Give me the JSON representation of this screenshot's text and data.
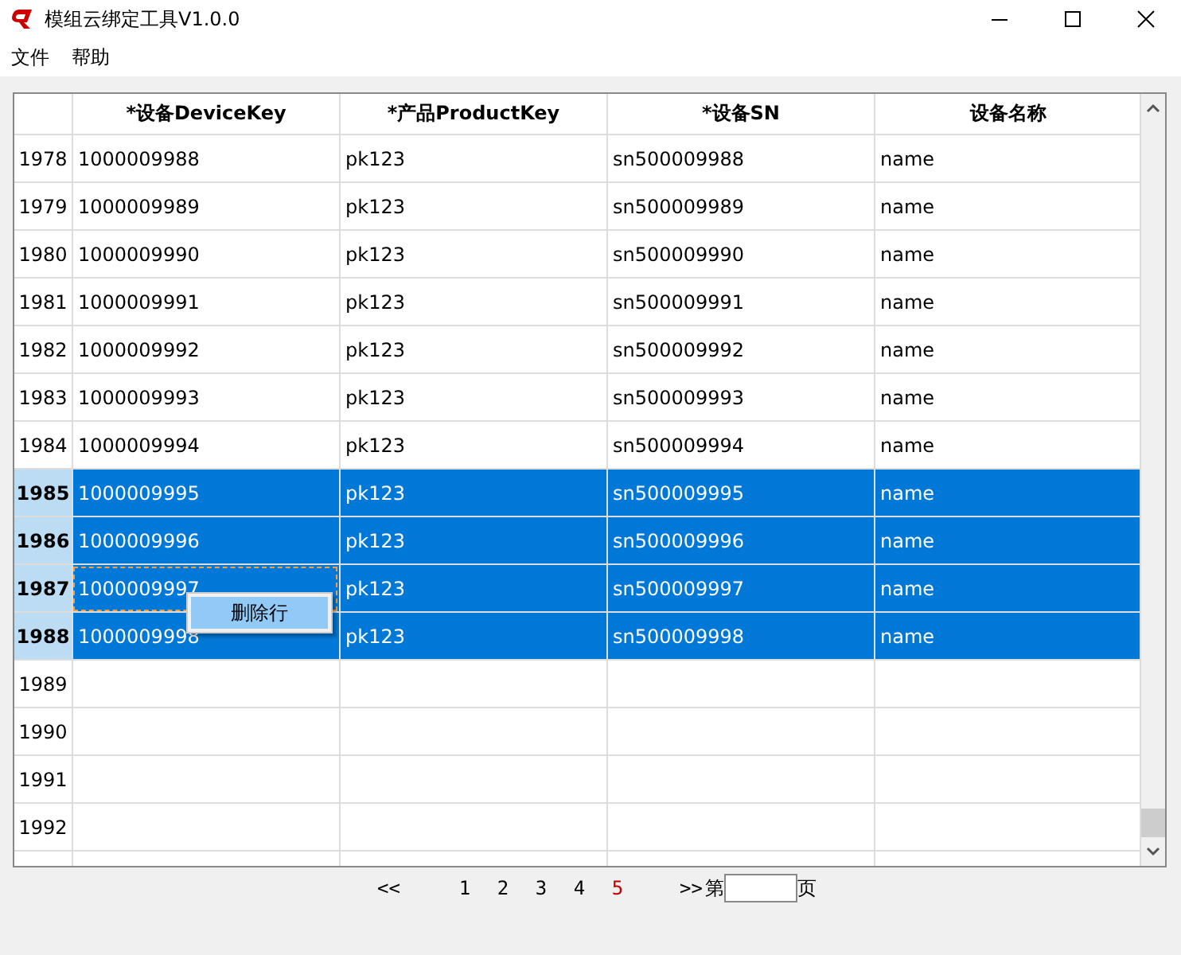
{
  "window": {
    "title": "模组云绑定工具V1.0.0"
  },
  "menu": [
    "文件",
    "帮助"
  ],
  "table": {
    "columns": [
      "*设备DeviceKey",
      "*产品ProductKey",
      "*设备SN",
      "设备名称"
    ],
    "rows": [
      {
        "number": "1978",
        "cells": [
          "1000009988",
          "pk123",
          "sn500009988",
          "name"
        ],
        "selected": false,
        "focused": false
      },
      {
        "number": "1979",
        "cells": [
          "1000009989",
          "pk123",
          "sn500009989",
          "name"
        ],
        "selected": false,
        "focused": false
      },
      {
        "number": "1980",
        "cells": [
          "1000009990",
          "pk123",
          "sn500009990",
          "name"
        ],
        "selected": false,
        "focused": false
      },
      {
        "number": "1981",
        "cells": [
          "1000009991",
          "pk123",
          "sn500009991",
          "name"
        ],
        "selected": false,
        "focused": false
      },
      {
        "number": "1982",
        "cells": [
          "1000009992",
          "pk123",
          "sn500009992",
          "name"
        ],
        "selected": false,
        "focused": false
      },
      {
        "number": "1983",
        "cells": [
          "1000009993",
          "pk123",
          "sn500009993",
          "name"
        ],
        "selected": false,
        "focused": false
      },
      {
        "number": "1984",
        "cells": [
          "1000009994",
          "pk123",
          "sn500009994",
          "name"
        ],
        "selected": false,
        "focused": false
      },
      {
        "number": "1985",
        "cells": [
          "1000009995",
          "pk123",
          "sn500009995",
          "name"
        ],
        "selected": true,
        "focused": false
      },
      {
        "number": "1986",
        "cells": [
          "1000009996",
          "pk123",
          "sn500009996",
          "name"
        ],
        "selected": true,
        "focused": false
      },
      {
        "number": "1987",
        "cells": [
          "1000009997",
          "pk123",
          "sn500009997",
          "name"
        ],
        "selected": true,
        "focused": true
      },
      {
        "number": "1988",
        "cells": [
          "1000009998",
          "pk123",
          "sn500009998",
          "name"
        ],
        "selected": true,
        "focused": false
      },
      {
        "number": "1989",
        "selected": false,
        "focused": false
      },
      {
        "number": "1990",
        "selected": false,
        "focused": false
      },
      {
        "number": "1991",
        "selected": false,
        "focused": false
      },
      {
        "number": "1992",
        "selected": false,
        "focused": false
      }
    ]
  },
  "context_menu": {
    "items": [
      {
        "label": "删除行",
        "selected": true
      }
    ]
  },
  "pager": {
    "prev": "<<",
    "pages": [
      {
        "label": "1",
        "selected": false
      },
      {
        "label": "2",
        "selected": false
      },
      {
        "label": "3",
        "selected": false
      },
      {
        "label": "4",
        "selected": false
      },
      {
        "label": "5",
        "selected": true
      }
    ],
    "next": ">>",
    "prefix": "第",
    "suffix": "页"
  }
}
